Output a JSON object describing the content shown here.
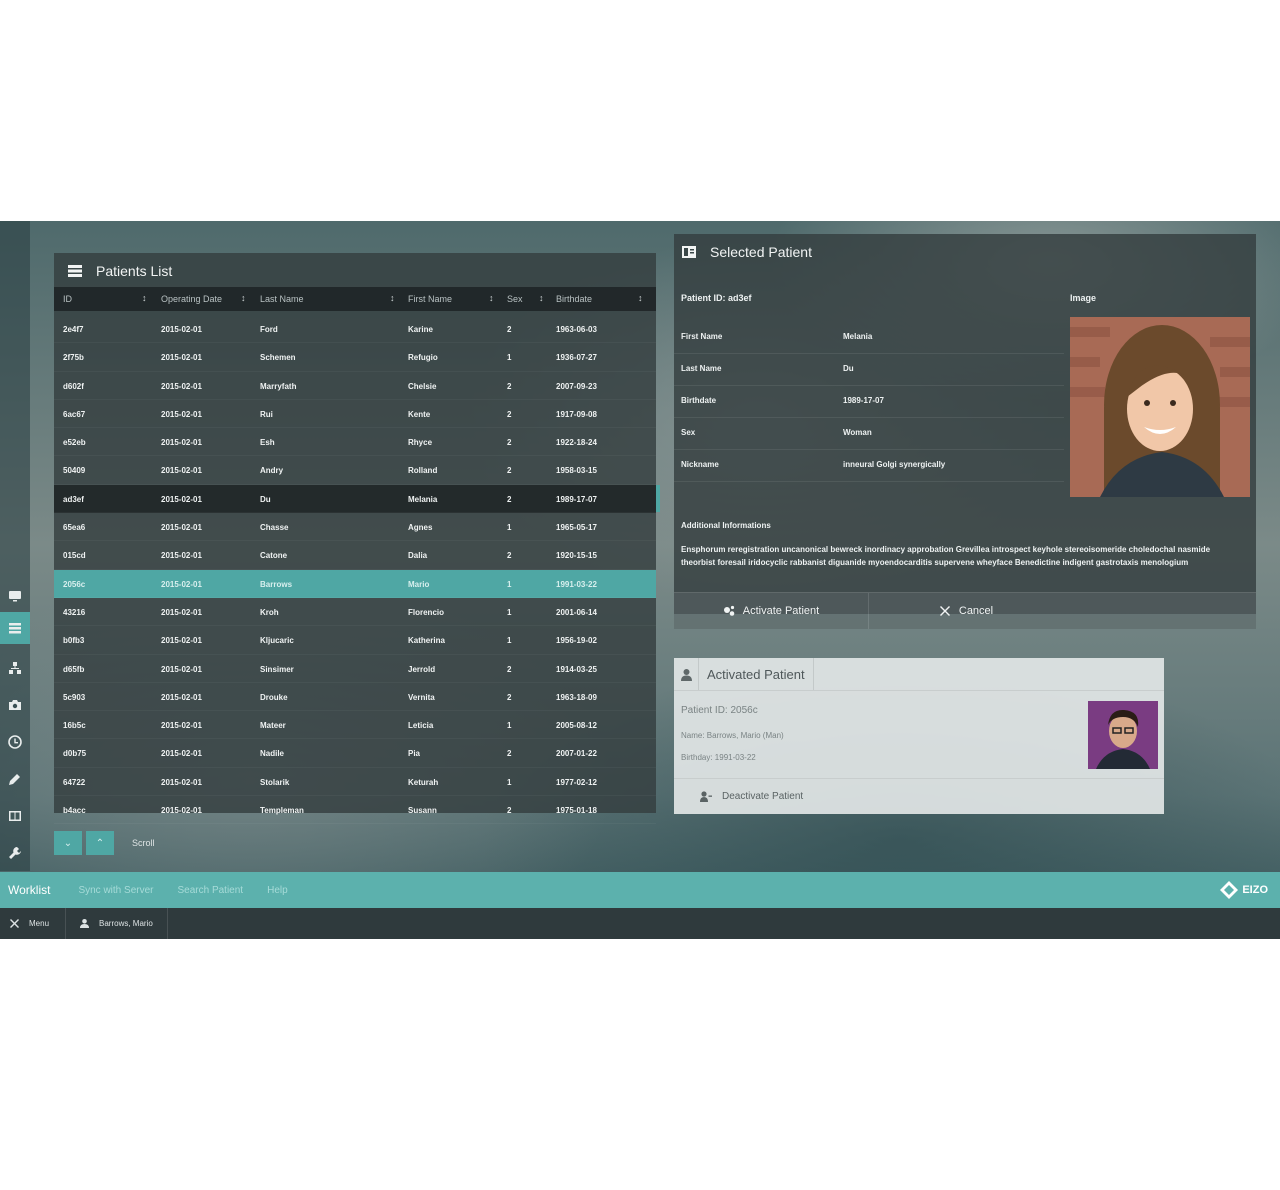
{
  "sidebar": {
    "icons": [
      "monitor-icon",
      "list-icon",
      "hierarchy-icon",
      "camera-icon",
      "clock-icon",
      "pencil-icon",
      "columns-icon",
      "wrench-icon"
    ],
    "active_index": 1
  },
  "patients_list": {
    "title": "Patients List",
    "columns": [
      "ID",
      "Operating Date",
      "Last Name",
      "First Name",
      "Sex",
      "Birthdate"
    ],
    "rows": [
      {
        "id": "2e4f7",
        "date": "2015-02-01",
        "last": "Ford",
        "first": "Karine",
        "sex": "2",
        "birth": "1963-06-03"
      },
      {
        "id": "2f75b",
        "date": "2015-02-01",
        "last": "Schemen",
        "first": "Refugio",
        "sex": "1",
        "birth": "1936-07-27"
      },
      {
        "id": "d602f",
        "date": "2015-02-01",
        "last": "Marryfath",
        "first": "Chelsie",
        "sex": "2",
        "birth": "2007-09-23"
      },
      {
        "id": "6ac67",
        "date": "2015-02-01",
        "last": "Rui",
        "first": "Kente",
        "sex": "2",
        "birth": "1917-09-08"
      },
      {
        "id": "e52eb",
        "date": "2015-02-01",
        "last": "Esh",
        "first": "Rhyce",
        "sex": "2",
        "birth": "1922-18-24"
      },
      {
        "id": "50409",
        "date": "2015-02-01",
        "last": "Andry",
        "first": "Rolland",
        "sex": "2",
        "birth": "1958-03-15"
      },
      {
        "id": "ad3ef",
        "date": "2015-02-01",
        "last": "Du",
        "first": "Melania",
        "sex": "2",
        "birth": "1989-17-07"
      },
      {
        "id": "65ea6",
        "date": "2015-02-01",
        "last": "Chasse",
        "first": "Agnes",
        "sex": "1",
        "birth": "1965-05-17"
      },
      {
        "id": "015cd",
        "date": "2015-02-01",
        "last": "Catone",
        "first": "Dalia",
        "sex": "2",
        "birth": "1920-15-15"
      },
      {
        "id": "2056c",
        "date": "2015-02-01",
        "last": "Barrows",
        "first": "Mario",
        "sex": "1",
        "birth": "1991-03-22"
      },
      {
        "id": "43216",
        "date": "2015-02-01",
        "last": "Kroh",
        "first": "Florencio",
        "sex": "1",
        "birth": "2001-06-14"
      },
      {
        "id": "b0fb3",
        "date": "2015-02-01",
        "last": "Kljucaric",
        "first": "Katherina",
        "sex": "1",
        "birth": "1956-19-02"
      },
      {
        "id": "d65fb",
        "date": "2015-02-01",
        "last": "Sinsimer",
        "first": "Jerrold",
        "sex": "2",
        "birth": "1914-03-25"
      },
      {
        "id": "5c903",
        "date": "2015-02-01",
        "last": "Drouke",
        "first": "Vernita",
        "sex": "2",
        "birth": "1963-18-09"
      },
      {
        "id": "16b5c",
        "date": "2015-02-01",
        "last": "Mateer",
        "first": "Leticia",
        "sex": "1",
        "birth": "2005-08-12"
      },
      {
        "id": "d0b75",
        "date": "2015-02-01",
        "last": "Nadile",
        "first": "Pia",
        "sex": "2",
        "birth": "2007-01-22"
      },
      {
        "id": "64722",
        "date": "2015-02-01",
        "last": "Stolarik",
        "first": "Keturah",
        "sex": "1",
        "birth": "1977-02-12"
      },
      {
        "id": "b4acc",
        "date": "2015-02-01",
        "last": "Templeman",
        "first": "Susann",
        "sex": "2",
        "birth": "1975-01-18"
      }
    ],
    "selected_row": 6,
    "active_row": 9
  },
  "pager": {
    "down": "⌄",
    "up": "⌃",
    "label": "Scroll"
  },
  "selected_patient": {
    "title": "Selected Patient",
    "patient_id": "Patient ID: ad3ef",
    "image_label": "Image",
    "fields": [
      {
        "label": "First Name",
        "value": "Melania"
      },
      {
        "label": "Last Name",
        "value": "Du"
      },
      {
        "label": "Birthdate",
        "value": "1989-17-07"
      },
      {
        "label": "Sex",
        "value": "Woman"
      },
      {
        "label": "Nickname",
        "value": "inneural Golgi synergically"
      }
    ],
    "additional_label": "Additional Informations",
    "additional_text": "Ensphorum reregistration uncanonical bewreck inordinacy approbation Grevillea introspect keyhole stereoisomeride choledochal nasmide theorbist foresail iridocyclic rabbanist diguanide myoendocarditis supervene wheyface Benedictine indigent gastrotaxis menologium",
    "activate_label": "Activate Patient",
    "cancel_label": "Cancel"
  },
  "activated_patient": {
    "title": "Activated Patient",
    "patient_id": "Patient ID: 2056c",
    "name": "Name: Barrows, Mario (Man)",
    "birthday": "Birthday: 1991-03-22",
    "deactivate_label": "Deactivate Patient"
  },
  "navbar": {
    "items": [
      "Worklist",
      "Sync with Server",
      "Search Patient",
      "Help"
    ],
    "logo": "EIZO"
  },
  "statusbar": {
    "menu_label": "Menu",
    "user_label": "Barrows, Mario"
  },
  "colors": {
    "accent": "#5cb1ad",
    "panel": "#343e40",
    "statusbar": "#2f3a3d"
  }
}
